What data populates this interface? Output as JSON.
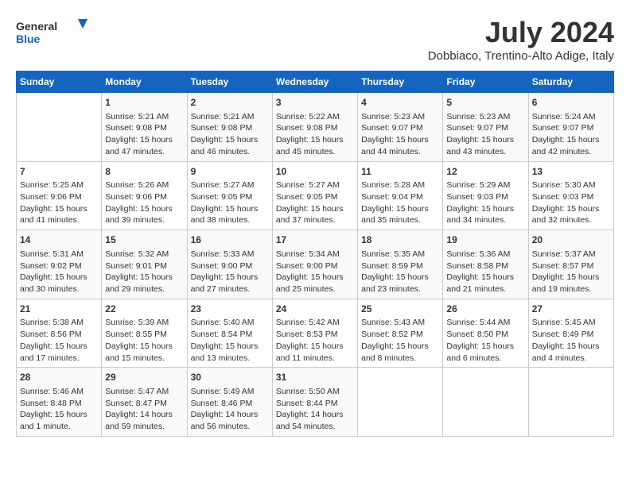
{
  "header": {
    "logo_line1": "General",
    "logo_line2": "Blue",
    "month_year": "July 2024",
    "location": "Dobbiaco, Trentino-Alto Adige, Italy"
  },
  "days_of_week": [
    "Sunday",
    "Monday",
    "Tuesday",
    "Wednesday",
    "Thursday",
    "Friday",
    "Saturday"
  ],
  "weeks": [
    [
      {
        "day": "",
        "info": ""
      },
      {
        "day": "1",
        "info": "Sunrise: 5:21 AM\nSunset: 9:08 PM\nDaylight: 15 hours\nand 47 minutes."
      },
      {
        "day": "2",
        "info": "Sunrise: 5:21 AM\nSunset: 9:08 PM\nDaylight: 15 hours\nand 46 minutes."
      },
      {
        "day": "3",
        "info": "Sunrise: 5:22 AM\nSunset: 9:08 PM\nDaylight: 15 hours\nand 45 minutes."
      },
      {
        "day": "4",
        "info": "Sunrise: 5:23 AM\nSunset: 9:07 PM\nDaylight: 15 hours\nand 44 minutes."
      },
      {
        "day": "5",
        "info": "Sunrise: 5:23 AM\nSunset: 9:07 PM\nDaylight: 15 hours\nand 43 minutes."
      },
      {
        "day": "6",
        "info": "Sunrise: 5:24 AM\nSunset: 9:07 PM\nDaylight: 15 hours\nand 42 minutes."
      }
    ],
    [
      {
        "day": "7",
        "info": "Sunrise: 5:25 AM\nSunset: 9:06 PM\nDaylight: 15 hours\nand 41 minutes."
      },
      {
        "day": "8",
        "info": "Sunrise: 5:26 AM\nSunset: 9:06 PM\nDaylight: 15 hours\nand 39 minutes."
      },
      {
        "day": "9",
        "info": "Sunrise: 5:27 AM\nSunset: 9:05 PM\nDaylight: 15 hours\nand 38 minutes."
      },
      {
        "day": "10",
        "info": "Sunrise: 5:27 AM\nSunset: 9:05 PM\nDaylight: 15 hours\nand 37 minutes."
      },
      {
        "day": "11",
        "info": "Sunrise: 5:28 AM\nSunset: 9:04 PM\nDaylight: 15 hours\nand 35 minutes."
      },
      {
        "day": "12",
        "info": "Sunrise: 5:29 AM\nSunset: 9:03 PM\nDaylight: 15 hours\nand 34 minutes."
      },
      {
        "day": "13",
        "info": "Sunrise: 5:30 AM\nSunset: 9:03 PM\nDaylight: 15 hours\nand 32 minutes."
      }
    ],
    [
      {
        "day": "14",
        "info": "Sunrise: 5:31 AM\nSunset: 9:02 PM\nDaylight: 15 hours\nand 30 minutes."
      },
      {
        "day": "15",
        "info": "Sunrise: 5:32 AM\nSunset: 9:01 PM\nDaylight: 15 hours\nand 29 minutes."
      },
      {
        "day": "16",
        "info": "Sunrise: 5:33 AM\nSunset: 9:00 PM\nDaylight: 15 hours\nand 27 minutes."
      },
      {
        "day": "17",
        "info": "Sunrise: 5:34 AM\nSunset: 9:00 PM\nDaylight: 15 hours\nand 25 minutes."
      },
      {
        "day": "18",
        "info": "Sunrise: 5:35 AM\nSunset: 8:59 PM\nDaylight: 15 hours\nand 23 minutes."
      },
      {
        "day": "19",
        "info": "Sunrise: 5:36 AM\nSunset: 8:58 PM\nDaylight: 15 hours\nand 21 minutes."
      },
      {
        "day": "20",
        "info": "Sunrise: 5:37 AM\nSunset: 8:57 PM\nDaylight: 15 hours\nand 19 minutes."
      }
    ],
    [
      {
        "day": "21",
        "info": "Sunrise: 5:38 AM\nSunset: 8:56 PM\nDaylight: 15 hours\nand 17 minutes."
      },
      {
        "day": "22",
        "info": "Sunrise: 5:39 AM\nSunset: 8:55 PM\nDaylight: 15 hours\nand 15 minutes."
      },
      {
        "day": "23",
        "info": "Sunrise: 5:40 AM\nSunset: 8:54 PM\nDaylight: 15 hours\nand 13 minutes."
      },
      {
        "day": "24",
        "info": "Sunrise: 5:42 AM\nSunset: 8:53 PM\nDaylight: 15 hours\nand 11 minutes."
      },
      {
        "day": "25",
        "info": "Sunrise: 5:43 AM\nSunset: 8:52 PM\nDaylight: 15 hours\nand 8 minutes."
      },
      {
        "day": "26",
        "info": "Sunrise: 5:44 AM\nSunset: 8:50 PM\nDaylight: 15 hours\nand 6 minutes."
      },
      {
        "day": "27",
        "info": "Sunrise: 5:45 AM\nSunset: 8:49 PM\nDaylight: 15 hours\nand 4 minutes."
      }
    ],
    [
      {
        "day": "28",
        "info": "Sunrise: 5:46 AM\nSunset: 8:48 PM\nDaylight: 15 hours\nand 1 minute."
      },
      {
        "day": "29",
        "info": "Sunrise: 5:47 AM\nSunset: 8:47 PM\nDaylight: 14 hours\nand 59 minutes."
      },
      {
        "day": "30",
        "info": "Sunrise: 5:49 AM\nSunset: 8:46 PM\nDaylight: 14 hours\nand 56 minutes."
      },
      {
        "day": "31",
        "info": "Sunrise: 5:50 AM\nSunset: 8:44 PM\nDaylight: 14 hours\nand 54 minutes."
      },
      {
        "day": "",
        "info": ""
      },
      {
        "day": "",
        "info": ""
      },
      {
        "day": "",
        "info": ""
      }
    ]
  ]
}
